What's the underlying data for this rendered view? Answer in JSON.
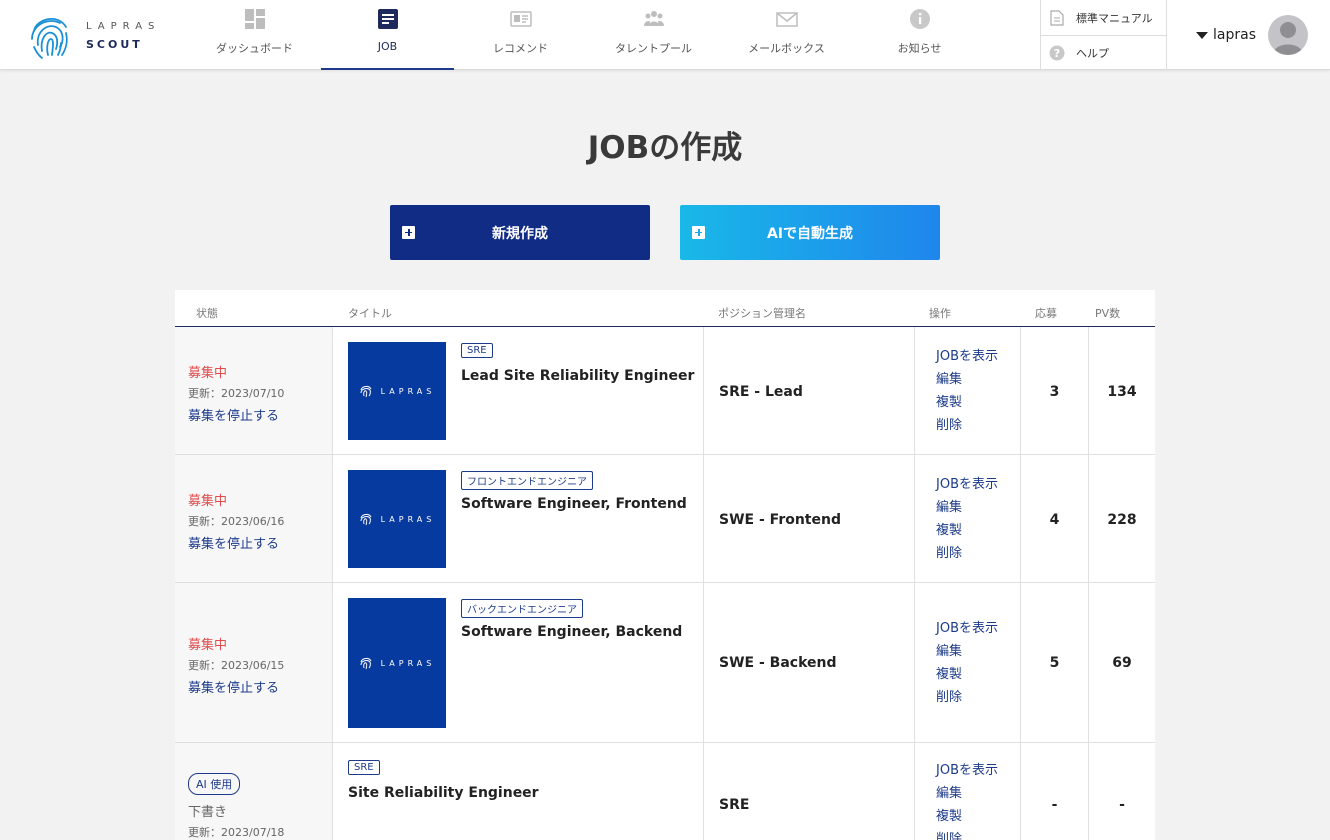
{
  "header": {
    "logo_top": "LAPRAS",
    "logo_bottom": "SCOUT",
    "nav": [
      {
        "label": "ダッシュボード",
        "icon": "dashboard-icon",
        "active": false
      },
      {
        "label": "JOB",
        "icon": "document-icon",
        "active": true
      },
      {
        "label": "レコメンド",
        "icon": "profile-card-icon",
        "active": false
      },
      {
        "label": "タレントプール",
        "icon": "people-icon",
        "active": false
      },
      {
        "label": "メールボックス",
        "icon": "mail-icon",
        "active": false
      },
      {
        "label": "お知らせ",
        "icon": "info-icon",
        "active": false
      }
    ],
    "manual_label": "標準マニュアル",
    "help_label": "ヘルプ",
    "username": "lapras"
  },
  "page": {
    "title": "JOBの作成",
    "new_button": "新規作成",
    "ai_button": "AIで自動生成"
  },
  "table": {
    "headers": {
      "status": "状態",
      "title": "タイトル",
      "position": "ポジション管理名",
      "ops": "操作",
      "applications": "応募",
      "pv": "PV数"
    },
    "ops_labels": {
      "view": "JOBを表示",
      "edit": "編集",
      "copy": "複製",
      "delete": "削除"
    },
    "thumb_text": "LAPRAS",
    "rows": [
      {
        "status": "募集中",
        "updated": "更新：2023/07/10",
        "stop": "募集を停止する",
        "tag": "SRE",
        "title": "Lead Site Reliability Engineer",
        "position": "SRE - Lead",
        "applications": "3",
        "pv": "134"
      },
      {
        "status": "募集中",
        "updated": "更新：2023/06/16",
        "stop": "募集を停止する",
        "tag": "フロントエンドエンジニア",
        "title": "Software Engineer, Frontend",
        "position": "SWE - Frontend",
        "applications": "4",
        "pv": "228"
      },
      {
        "status": "募集中",
        "updated": "更新：2023/06/15",
        "stop": "募集を停止する",
        "tag": "バックエンドエンジニア",
        "title": "Software Engineer, Backend",
        "position": "SWE - Backend",
        "applications": "5",
        "pv": "69"
      },
      {
        "ai_badge": "AI 使用",
        "status": "下書き",
        "updated": "更新：2023/07/18",
        "tag": "SRE",
        "title": "Site Reliability Engineer",
        "position": "SRE",
        "applications": "-",
        "pv": "-"
      }
    ]
  },
  "colors": {
    "primary": "#102c84",
    "accent_gradient_start": "#19b8e8",
    "accent_gradient_end": "#1f86ec",
    "status_active": "#e04b4b",
    "thumb_bg": "#073a9e"
  }
}
